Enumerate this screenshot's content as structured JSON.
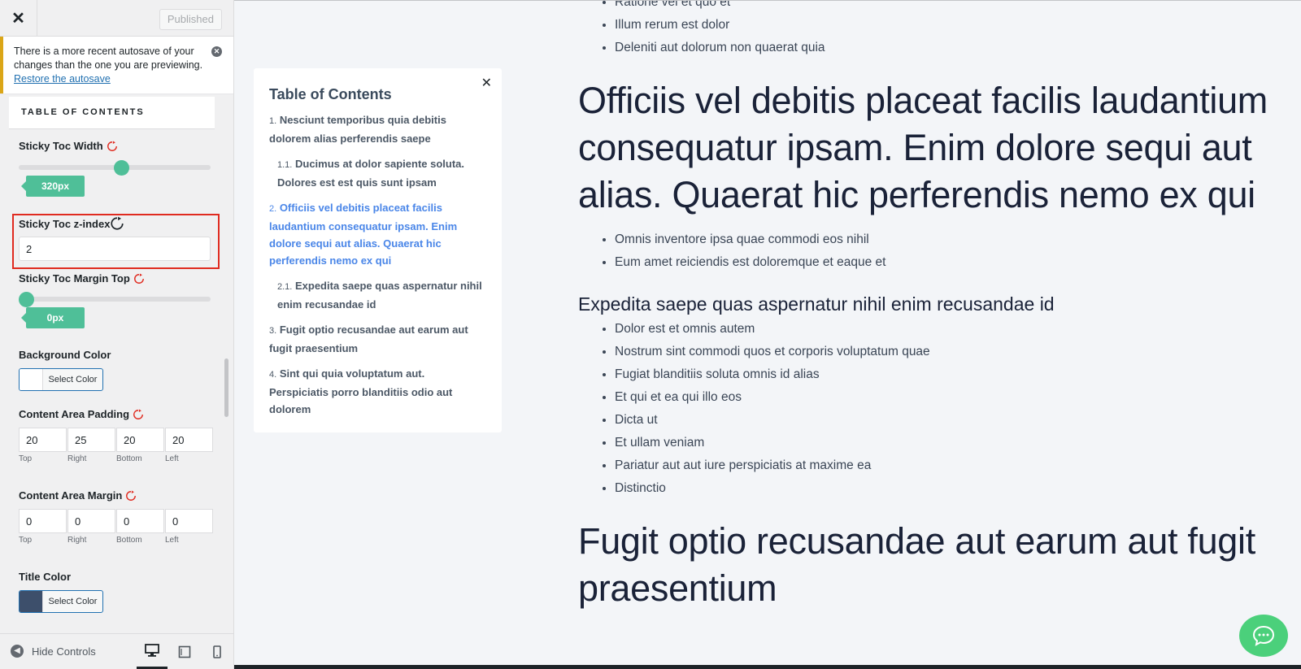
{
  "header": {
    "close_label": "✕",
    "publish_label": "Published"
  },
  "notice": {
    "text": "There is a more recent autosave of your changes than the one you are previewing. ",
    "link": "Restore the autosave",
    "dismiss": "✕"
  },
  "section": {
    "title": "TABLE OF CONTENTS"
  },
  "controls": {
    "width": {
      "label": "Sticky Toc Width",
      "value": "320px",
      "fraction": 0.54
    },
    "zindex": {
      "label": "Sticky Toc z-index",
      "value": "2"
    },
    "margin_top": {
      "label": "Sticky Toc Margin Top",
      "value": "0px",
      "fraction": 0.0
    },
    "bg_color": {
      "label": "Background Color",
      "button": "Select Color",
      "swatch": "#ffffff"
    },
    "padding": {
      "label": "Content Area Padding",
      "values": [
        "20",
        "25",
        "20",
        "20"
      ],
      "sides": [
        "Top",
        "Right",
        "Bottom",
        "Left"
      ]
    },
    "margin": {
      "label": "Content Area Margin",
      "values": [
        "0",
        "0",
        "0",
        "0"
      ],
      "sides": [
        "Top",
        "Right",
        "Bottom",
        "Left"
      ]
    },
    "title_color": {
      "label": "Title Color",
      "button": "Select Color",
      "swatch": "#3d4f6b"
    }
  },
  "footer": {
    "hide_label": "Hide Controls"
  },
  "toc": {
    "title": "Table of Contents",
    "items": [
      {
        "num": "1.",
        "text": "Nesciunt temporibus quia debitis dolorem alias perferendis saepe"
      },
      {
        "num": "1.1.",
        "text": "Ducimus at dolor sapiente soluta. Dolores est est quis sunt ipsam"
      },
      {
        "num": "2.",
        "text": "Officiis vel debitis placeat facilis laudantium consequatur ipsam. Enim dolore sequi aut alias. Quaerat hic perferendis nemo ex qui"
      },
      {
        "num": "2.1.",
        "text": "Expedita saepe quas aspernatur nihil enim recusandae id"
      },
      {
        "num": "3.",
        "text": "Fugit optio recusandae aut earum aut fugit praesentium"
      },
      {
        "num": "4.",
        "text": "Sint qui quia voluptatum aut. Perspiciatis porro blanditiis odio aut dolorem"
      }
    ]
  },
  "article": {
    "list1": [
      "Ratione vel et quo et",
      "Illum rerum est dolor",
      "Deleniti aut dolorum non quaerat quia"
    ],
    "h2a": "Officiis vel debitis placeat facilis laudantium consequatur ipsam. Enim dolore sequi aut alias. Quaerat hic perferendis nemo ex qui",
    "list2": [
      "Omnis inventore ipsa quae commodi eos nihil",
      "Eum amet reiciendis est doloremque et eaque et"
    ],
    "h3": "Expedita saepe quas aspernatur nihil enim recusandae id",
    "list3": [
      "Dolor est et omnis autem",
      "Nostrum sint commodi quos et corporis voluptatum quae",
      "Fugiat blanditiis soluta omnis id alias",
      "Et qui et ea qui illo eos",
      "Dicta ut",
      "Et ullam veniam",
      "Pariatur aut aut iure perspiciatis at maxime ea",
      "Distinctio"
    ],
    "h2b": "Fugit optio recusandae aut earum aut fugit praesentium"
  },
  "colors": {
    "accent": "#4fbf98",
    "highlight": "#e02b20",
    "toc_active": "#4a86e8",
    "chat": "#4bd07b"
  }
}
